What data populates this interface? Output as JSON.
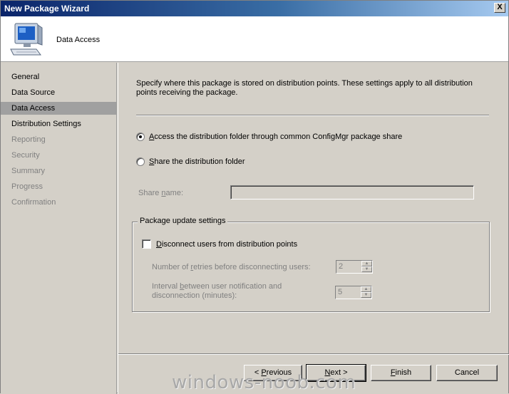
{
  "window": {
    "title": "New Package Wizard",
    "close_label": "X"
  },
  "header": {
    "page_title": "Data Access",
    "icon": "computer-icon"
  },
  "sidebar": {
    "items": [
      {
        "label": "General",
        "state": "enabled"
      },
      {
        "label": "Data Source",
        "state": "enabled"
      },
      {
        "label": "Data Access",
        "state": "active"
      },
      {
        "label": "Distribution Settings",
        "state": "enabled"
      },
      {
        "label": "Reporting",
        "state": "disabled"
      },
      {
        "label": "Security",
        "state": "disabled"
      },
      {
        "label": "Summary",
        "state": "disabled"
      },
      {
        "label": "Progress",
        "state": "disabled"
      },
      {
        "label": "Confirmation",
        "state": "disabled"
      }
    ]
  },
  "content": {
    "description": "Specify where this package is stored on distribution points. These settings apply to all distribution points receiving the package.",
    "radio_common_share": {
      "pre": "",
      "accel": "A",
      "post": "ccess the distribution folder through common ConfigMgr package share",
      "checked": true
    },
    "radio_share_folder": {
      "pre": "",
      "accel": "S",
      "post": "hare the distribution folder",
      "checked": false
    },
    "share_name": {
      "label_pre": "Share ",
      "label_accel": "n",
      "label_post": "ame:",
      "value": ""
    },
    "package_update": {
      "group_title": "Package update settings",
      "disconnect_checkbox": {
        "pre": "",
        "accel": "D",
        "post": "isconnect users from distribution points",
        "checked": false
      },
      "retries": {
        "label_pre": "Number of ",
        "label_accel": "r",
        "label_post": "etries before disconnecting users:",
        "value": "2"
      },
      "interval": {
        "label_line1_pre": "Interval ",
        "label_line1_accel": "b",
        "label_line1_post": "etween user notification and",
        "label_line2": "disconnection (minutes):",
        "value": "5"
      }
    }
  },
  "buttons": {
    "previous": {
      "pre": "< ",
      "accel": "P",
      "post": "revious"
    },
    "next": {
      "pre": "",
      "accel": "N",
      "post": "ext >"
    },
    "finish": {
      "pre": "",
      "accel": "F",
      "post": "inish"
    },
    "cancel": {
      "label": "Cancel"
    }
  },
  "watermark": "windows-noob.com"
}
